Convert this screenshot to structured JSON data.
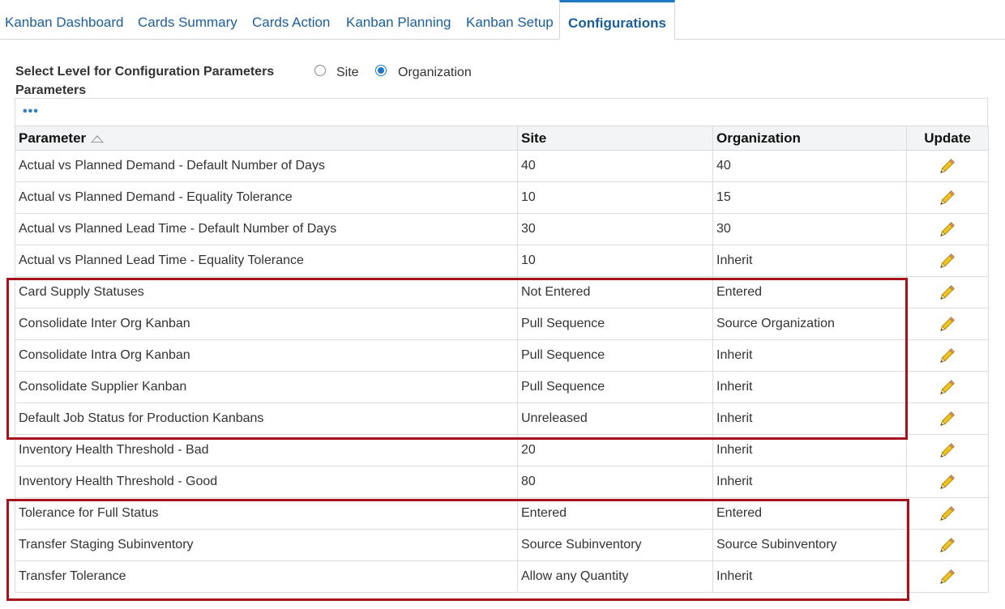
{
  "tabs": [
    {
      "label": "Kanban Dashboard"
    },
    {
      "label": "Cards Summary"
    },
    {
      "label": "Cards Action"
    },
    {
      "label": "Kanban Planning"
    },
    {
      "label": "Kanban Setup"
    },
    {
      "label": "Configurations",
      "active": true
    }
  ],
  "level": {
    "label": "Select Level for Configuration Parameters",
    "options": [
      {
        "label": "Site",
        "checked": false
      },
      {
        "label": "Organization",
        "checked": true
      }
    ]
  },
  "parameters": {
    "title": "Parameters",
    "more_icon": "ellipsis-icon",
    "columns": {
      "parameter": "Parameter",
      "site": "Site",
      "organization": "Organization",
      "update": "Update"
    },
    "rows": [
      {
        "parameter": "Actual vs Planned Demand - Default Number of Days",
        "site": "40",
        "organization": "40"
      },
      {
        "parameter": "Actual vs Planned Demand - Equality Tolerance",
        "site": "10",
        "organization": "15"
      },
      {
        "parameter": "Actual vs Planned Lead Time - Default Number of Days",
        "site": "30",
        "organization": "30"
      },
      {
        "parameter": "Actual vs Planned Lead Time - Equality Tolerance",
        "site": "10",
        "organization": "Inherit"
      },
      {
        "parameter": "Card Supply Statuses",
        "site": "Not Entered",
        "organization": "Entered"
      },
      {
        "parameter": "Consolidate Inter Org Kanban",
        "site": "Pull Sequence",
        "organization": "Source Organization"
      },
      {
        "parameter": "Consolidate Intra Org Kanban",
        "site": "Pull Sequence",
        "organization": "Inherit"
      },
      {
        "parameter": "Consolidate Supplier Kanban",
        "site": "Pull Sequence",
        "organization": "Inherit"
      },
      {
        "parameter": "Default Job Status for Production Kanbans",
        "site": "Unreleased",
        "organization": "Inherit"
      },
      {
        "parameter": "Inventory Health Threshold - Bad",
        "site": "20",
        "organization": "Inherit"
      },
      {
        "parameter": "Inventory Health Threshold - Good",
        "site": "80",
        "organization": "Inherit"
      },
      {
        "parameter": "Tolerance for Full Status",
        "site": "Entered",
        "organization": "Entered"
      },
      {
        "parameter": "Transfer Staging Subinventory",
        "site": "Source Subinventory",
        "organization": "Source Subinventory"
      },
      {
        "parameter": "Transfer Tolerance",
        "site": "Allow any Quantity",
        "organization": "Inherit"
      }
    ]
  },
  "colors": {
    "tab_text": "#1a5f9c",
    "active_tab_border": "#1f78c1",
    "highlight_box": "#a5121c",
    "pencil": "#f2c21b"
  },
  "icons": {
    "sort": "sort-ascending-icon",
    "update": "pencil-icon"
  }
}
